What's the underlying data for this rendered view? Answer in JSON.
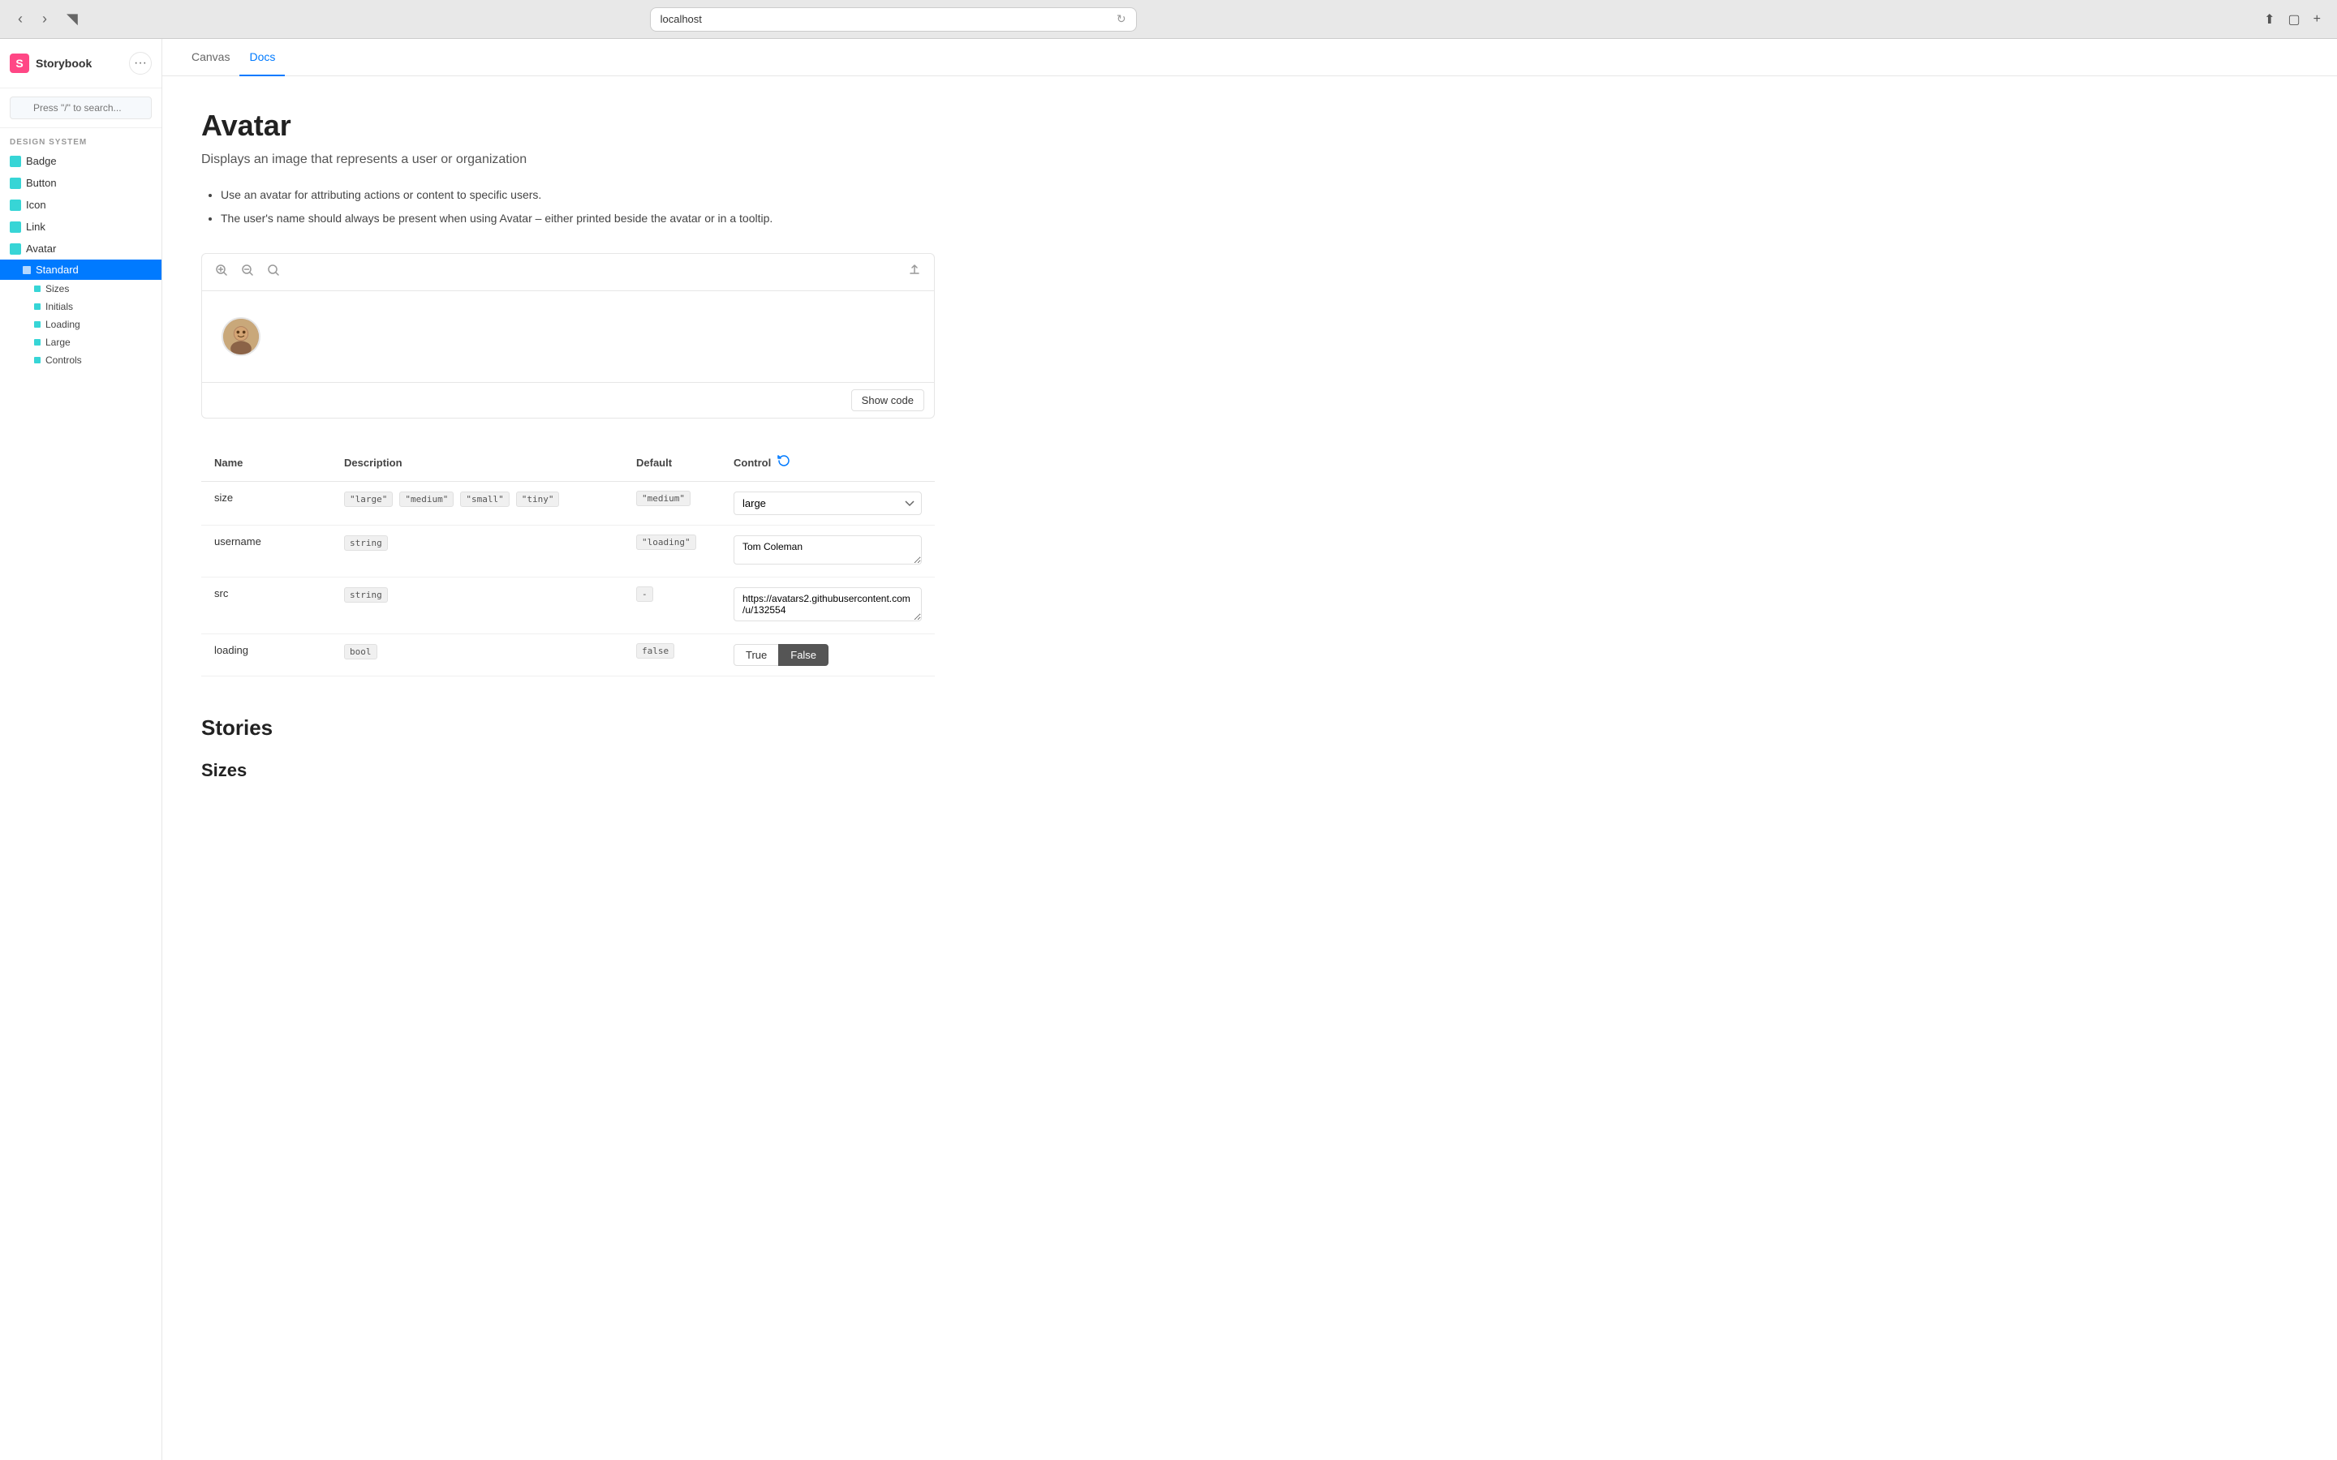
{
  "browser": {
    "url": "localhost",
    "nav": {
      "back": "‹",
      "forward": "›",
      "sidebar_toggle": "⊡",
      "share": "⬆",
      "new_tab": "+",
      "fullscreen": "⛶"
    }
  },
  "sidebar": {
    "logo_letter": "S",
    "app_name": "Storybook",
    "menu_icon": "···",
    "search_placeholder": "Press \"/\" to search...",
    "section_label": "DESIGN SYSTEM",
    "nav_items": [
      {
        "id": "badge",
        "label": "Badge",
        "level": 1
      },
      {
        "id": "button",
        "label": "Button",
        "level": 1
      },
      {
        "id": "icon",
        "label": "Icon",
        "level": 1
      },
      {
        "id": "link",
        "label": "Link",
        "level": 1
      },
      {
        "id": "avatar",
        "label": "Avatar",
        "level": 1,
        "expanded": true
      },
      {
        "id": "standard",
        "label": "Standard",
        "level": 2,
        "active": true
      },
      {
        "id": "sizes",
        "label": "Sizes",
        "level": 2
      },
      {
        "id": "initials",
        "label": "Initials",
        "level": 2
      },
      {
        "id": "loading",
        "label": "Loading",
        "level": 2
      },
      {
        "id": "large",
        "label": "Large",
        "level": 2
      },
      {
        "id": "controls",
        "label": "Controls",
        "level": 2
      }
    ]
  },
  "tabs": [
    {
      "id": "canvas",
      "label": "Canvas"
    },
    {
      "id": "docs",
      "label": "Docs",
      "active": true
    }
  ],
  "docs": {
    "title": "Avatar",
    "subtitle": "Displays an image that represents a user or organization",
    "usage_items": [
      "Use an avatar for attributing actions or content to specific users.",
      "The user's name should always be present when using Avatar – either printed beside the avatar or in a tooltip."
    ],
    "show_code_label": "Show code",
    "avatar_emoji": "👤",
    "props_table": {
      "columns": [
        "Name",
        "Description",
        "Default",
        "Control"
      ],
      "refresh_icon": "↻",
      "rows": [
        {
          "name": "size",
          "description_badges": [
            "\"large\"",
            "\"medium\"",
            "\"small\"",
            "\"tiny\""
          ],
          "default": "\"medium\"",
          "control_type": "select",
          "control_value": "large",
          "control_options": [
            "large",
            "medium",
            "small",
            "tiny"
          ]
        },
        {
          "name": "username",
          "description_badges": [
            "string"
          ],
          "default": "\"loading\"",
          "control_type": "textarea",
          "control_value": "Tom Coleman"
        },
        {
          "name": "src",
          "description_badges": [
            "string"
          ],
          "default": "-",
          "control_type": "textarea",
          "control_value": "https://avatars2.githubusercontent.com/u/132554"
        },
        {
          "name": "loading",
          "description_badges": [
            "bool"
          ],
          "default": "false",
          "control_type": "bool",
          "bool_options": [
            "True",
            "False"
          ],
          "bool_active": "False"
        }
      ]
    },
    "stories_title": "Stories",
    "sizes_title": "Sizes"
  }
}
